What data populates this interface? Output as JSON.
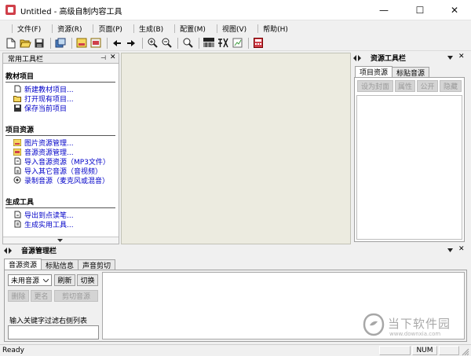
{
  "window": {
    "title": "Untitled - 高级自制内容工具",
    "minimize": "—",
    "maximize": "☐",
    "close": "✕"
  },
  "menu": [
    "文件(F)",
    "资源(R)",
    "页面(P)",
    "生成(B)",
    "配置(M)",
    "视图(V)",
    "帮助(H)"
  ],
  "left_panel": {
    "title": "常用工具栏",
    "pin": "⊣",
    "close": "✕",
    "groups": [
      {
        "title": "教材项目",
        "items": [
          "新建教材项目...",
          "打开现有项目...",
          "保存当前项目"
        ]
      },
      {
        "title": "项目资源",
        "items": [
          "图片资源管理...",
          "音源资源管理...",
          "导入音源资源（MP3文件）",
          "导入其它音源（音视频）",
          "录制音源（麦克风或混音）"
        ]
      },
      {
        "title": "生成工具",
        "items": [
          "导出到点读笔...",
          "生成实用工具..."
        ]
      }
    ]
  },
  "right_panel": {
    "title": "资源工具栏",
    "tabs": [
      "项目资源",
      "标贴音源"
    ],
    "buttons": [
      "设为封面",
      "属性",
      "公开",
      "隐藏"
    ]
  },
  "bottom_panel": {
    "title": "音源管理栏",
    "tabs": [
      "音源资源",
      "标贴信息",
      "声音剪切"
    ],
    "select_value": "未用音源",
    "buttons": [
      "刷新",
      "切换"
    ],
    "disabled_buttons": [
      "删除",
      "更名",
      "剪切音源"
    ],
    "filter_label": "输入关键字过滤右侧列表",
    "filter_value": ""
  },
  "status": {
    "text": "Ready",
    "num": "NUM"
  },
  "watermark": {
    "brand": "当下软件园",
    "url": "www.downxia.com"
  },
  "colors": {
    "link": "#0000c8",
    "workspace": "#ecebe0",
    "accent_red": "#d0404a"
  }
}
